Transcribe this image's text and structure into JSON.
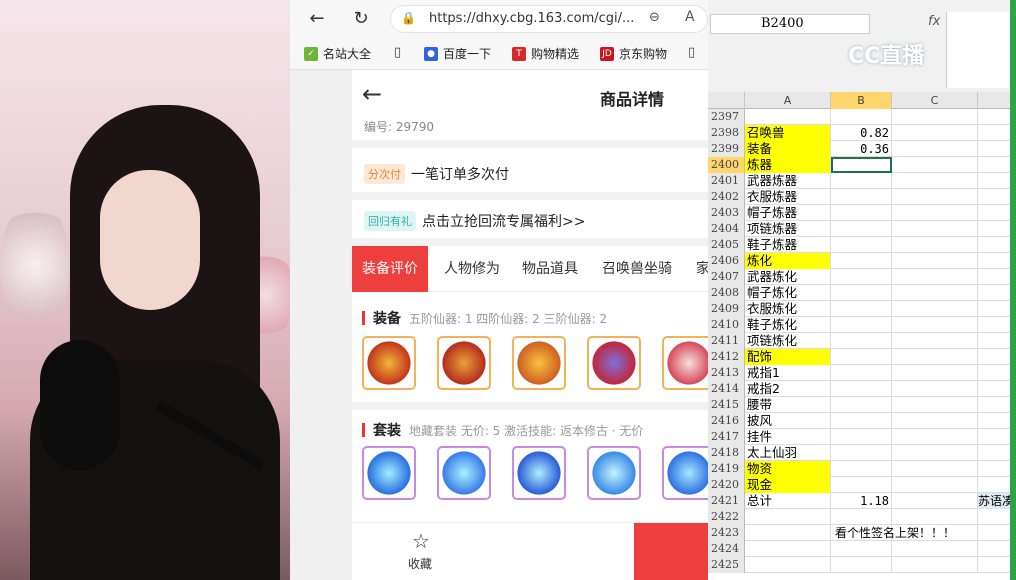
{
  "browser": {
    "url": "https://dhxy.cbg.163.com/cgi/...",
    "bookmarks": [
      "名站大全",
      "百度一下",
      "购物精选",
      "京东购物"
    ]
  },
  "page": {
    "title": "商品详情",
    "serial": "编号: 29790",
    "split_pay_tag": "分次付",
    "split_pay_text": "一笔订单多次付",
    "return_tag": "回归有礼",
    "return_text": "点击立抢回流专属福利>>",
    "tabs": [
      "装备评价",
      "人物修为",
      "物品道具",
      "召唤兽坐骑",
      "家"
    ],
    "equip": {
      "name": "装备",
      "summary": "五阶仙器: 1   四阶仙器: 2   三阶仙器: 2"
    },
    "suit": {
      "name": "套装",
      "summary": "地藏套装  无价: 5  激活技能: 返本修古 · 无价"
    },
    "footer_fav": "收藏"
  },
  "excel": {
    "name_box": "B2400",
    "fx": "fx",
    "logo": "CC直播",
    "columns": [
      "A",
      "B",
      "C"
    ],
    "rows": [
      {
        "n": "2397",
        "a": "",
        "b": "",
        "hl": false
      },
      {
        "n": "2398",
        "a": "召唤兽",
        "b": "0.82",
        "hl": true
      },
      {
        "n": "2399",
        "a": "装备",
        "b": "0.36",
        "hl": true
      },
      {
        "n": "2400",
        "a": "炼器",
        "b": "",
        "hl": true,
        "active": true
      },
      {
        "n": "2401",
        "a": "武器炼器",
        "b": "",
        "hl": false
      },
      {
        "n": "2402",
        "a": "衣服炼器",
        "b": "",
        "hl": false
      },
      {
        "n": "2403",
        "a": "帽子炼器",
        "b": "",
        "hl": false
      },
      {
        "n": "2404",
        "a": "项链炼器",
        "b": "",
        "hl": false
      },
      {
        "n": "2405",
        "a": "鞋子炼器",
        "b": "",
        "hl": false
      },
      {
        "n": "2406",
        "a": "炼化",
        "b": "",
        "hl": true
      },
      {
        "n": "2407",
        "a": "武器炼化",
        "b": "",
        "hl": false
      },
      {
        "n": "2408",
        "a": "帽子炼化",
        "b": "",
        "hl": false
      },
      {
        "n": "2409",
        "a": "衣服炼化",
        "b": "",
        "hl": false
      },
      {
        "n": "2410",
        "a": "鞋子炼化",
        "b": "",
        "hl": false
      },
      {
        "n": "2411",
        "a": "项链炼化",
        "b": "",
        "hl": false
      },
      {
        "n": "2412",
        "a": "配饰",
        "b": "",
        "hl": true
      },
      {
        "n": "2413",
        "a": "戒指1",
        "b": "",
        "hl": false
      },
      {
        "n": "2414",
        "a": "戒指2",
        "b": "",
        "hl": false
      },
      {
        "n": "2415",
        "a": "腰带",
        "b": "",
        "hl": false
      },
      {
        "n": "2416",
        "a": "披风",
        "b": "",
        "hl": false
      },
      {
        "n": "2417",
        "a": "挂件",
        "b": "",
        "hl": false
      },
      {
        "n": "2418",
        "a": "太上仙羽",
        "b": "",
        "hl": false
      },
      {
        "n": "2419",
        "a": "物资",
        "b": "",
        "hl": true
      },
      {
        "n": "2420",
        "a": "现金",
        "b": "",
        "hl": true
      },
      {
        "n": "2421",
        "a": "总计",
        "b": "1.18",
        "hl": false,
        "d": "苏语凑"
      },
      {
        "n": "2422",
        "a": "",
        "b": "",
        "hl": false
      },
      {
        "n": "2423",
        "a": "",
        "b": "",
        "hl": false,
        "bc": "看个性签名上架！！！"
      },
      {
        "n": "2424",
        "a": "",
        "b": "",
        "hl": false
      },
      {
        "n": "2425",
        "a": "",
        "b": "",
        "hl": false
      }
    ]
  }
}
